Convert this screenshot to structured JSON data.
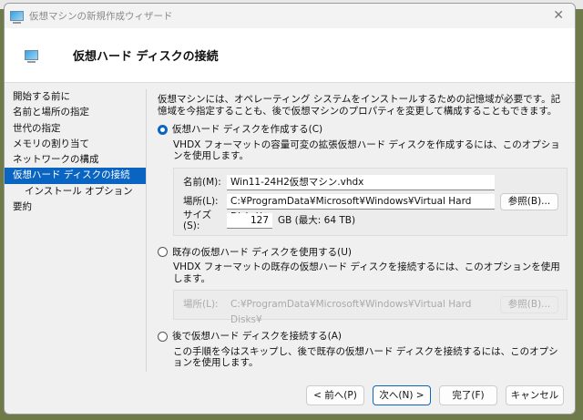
{
  "window": {
    "title": "仮想マシンの新規作成ウィザード",
    "close": "✕"
  },
  "header": {
    "title": "仮想ハード ディスクの接続"
  },
  "nav": {
    "items": [
      "開始する前に",
      "名前と場所の指定",
      "世代の指定",
      "メモリの割り当て",
      "ネットワークの構成",
      "仮想ハード ディスクの接続",
      "インストール オプション",
      "要約"
    ]
  },
  "intro": "仮想マシンには、オペレーティング システムをインストールするための記憶域が必要です。記憶域を今指定することも、後で仮想マシンのプロパティを変更して構成することもできます。",
  "create": {
    "label": "仮想ハード ディスクを作成する(C)",
    "desc": "VHDX フォーマットの容量可変の拡張仮想ハード ディスクを作成するには、このオプションを使用します。",
    "name_label": "名前(M):",
    "name_value": "Win11-24H2仮想マシン.vhdx",
    "loc_label": "場所(L):",
    "loc_value": "C:¥ProgramData¥Microsoft¥Windows¥Virtual Hard Disks¥",
    "browse": "参照(B)...",
    "size_label": "サイズ(S):",
    "size_value": "127",
    "size_unit": "GB (最大: 64 TB)"
  },
  "existing": {
    "label": "既存の仮想ハード ディスクを使用する(U)",
    "desc": "VHDX フォーマットの既存の仮想ハード ディスクを接続するには、このオプションを使用します。",
    "loc_label": "場所(L):",
    "loc_value": "C:¥ProgramData¥Microsoft¥Windows¥Virtual Hard Disks¥",
    "browse": "参照(B)..."
  },
  "later": {
    "label": "後で仮想ハード ディスクを接続する(A)",
    "desc": "この手順を今はスキップし、後で既存の仮想ハード ディスクを接続するには、このオプションを使用します。"
  },
  "footer": {
    "prev": "< 前へ(P)",
    "next": "次へ(N) >",
    "finish": "完了(F)",
    "cancel": "キャンセル"
  }
}
